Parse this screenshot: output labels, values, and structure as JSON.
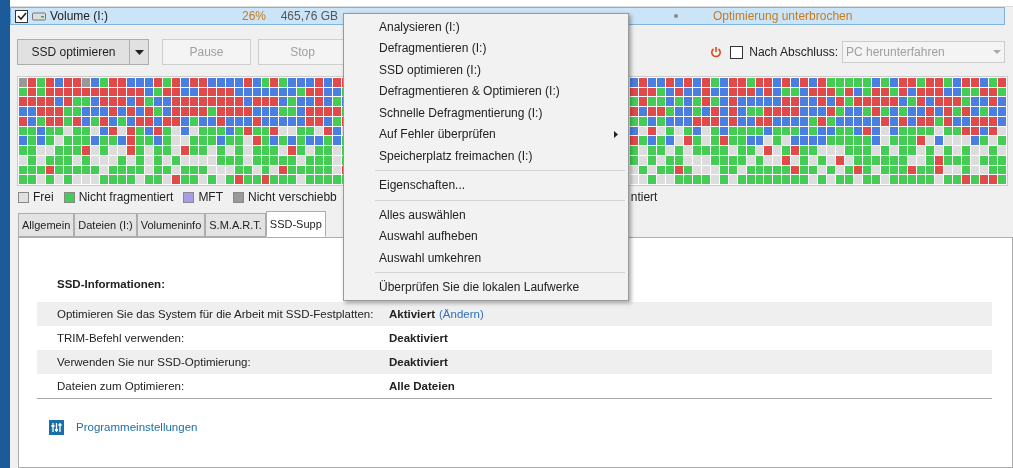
{
  "volume_row": {
    "checked": true,
    "name": "Volume (I:)",
    "percent": "26%",
    "size": "465,76 GB",
    "status": "Optimierung unterbrochen"
  },
  "toolbar": {
    "buttons": [
      {
        "label": "SSD optimieren",
        "kind": "split",
        "disabled": false
      },
      {
        "label": "Pause",
        "kind": "plain",
        "disabled": true
      },
      {
        "label": "Stop",
        "kind": "plain",
        "disabled": true
      }
    ],
    "on_finish": {
      "checked": false,
      "label": "Nach Abschluss:",
      "value": "PC herunterfahren",
      "disabled": true
    }
  },
  "legend": [
    {
      "label": "Frei",
      "color": "#e0e0e0"
    },
    {
      "label": "Nicht fragmentiert",
      "color": "#44cc55"
    },
    {
      "label": "MFT",
      "color": "#a89be8"
    },
    {
      "label": "Nicht verschiebb",
      "color": "#999999"
    },
    {
      "label": "ntiert"
    }
  ],
  "tabs": [
    {
      "label": "Allgemein",
      "selected": false
    },
    {
      "label": "Dateien (I:)",
      "selected": false
    },
    {
      "label": "Volumeninfo",
      "selected": false
    },
    {
      "label": "S.M.A.R.T.",
      "selected": false
    },
    {
      "label": "SSD-Supp",
      "selected": true
    }
  ],
  "ssd_info": {
    "heading": "SSD-Informationen:",
    "rows": [
      {
        "label": "Optimieren Sie das System für die Arbeit mit SSD-Festplatten:",
        "value": "Aktiviert",
        "link": "(Ändern)"
      },
      {
        "label": "TRIM-Befehl verwenden:",
        "value": "Deaktiviert"
      },
      {
        "label": "Verwenden Sie nur SSD-Optimierung:",
        "value": "Deaktiviert"
      },
      {
        "label": "Dateien zum Optimieren:",
        "value": "Alle Dateien"
      }
    ],
    "settings_link": "Programmeinstellungen"
  },
  "context_menu": {
    "items": [
      {
        "kind": "item",
        "label": "Analysieren (I:)",
        "submenu": false
      },
      {
        "kind": "item",
        "label": "Defragmentieren (I:)",
        "submenu": false
      },
      {
        "kind": "item",
        "label": "SSD optimieren (I:)",
        "submenu": false
      },
      {
        "kind": "item",
        "label": "Defragmentieren & Optimieren (I:)",
        "submenu": false
      },
      {
        "kind": "item",
        "label": "Schnelle Defragmentierung (I:)",
        "submenu": false
      },
      {
        "kind": "item",
        "label": "Auf Fehler überprüfen",
        "submenu": true
      },
      {
        "kind": "item",
        "label": "Speicherplatz freimachen (I:)",
        "submenu": false
      },
      {
        "kind": "separator"
      },
      {
        "kind": "item",
        "label": "Eigenschaften...",
        "submenu": false
      },
      {
        "kind": "separator"
      },
      {
        "kind": "item",
        "label": "Alles auswählen",
        "submenu": false
      },
      {
        "kind": "item",
        "label": "Auswahl aufheben",
        "submenu": false
      },
      {
        "kind": "item",
        "label": "Auswahl umkehren",
        "submenu": false
      },
      {
        "kind": "separator"
      },
      {
        "kind": "item",
        "label": "Überprüfen Sie die lokalen Laufwerke",
        "submenu": false
      }
    ]
  }
}
